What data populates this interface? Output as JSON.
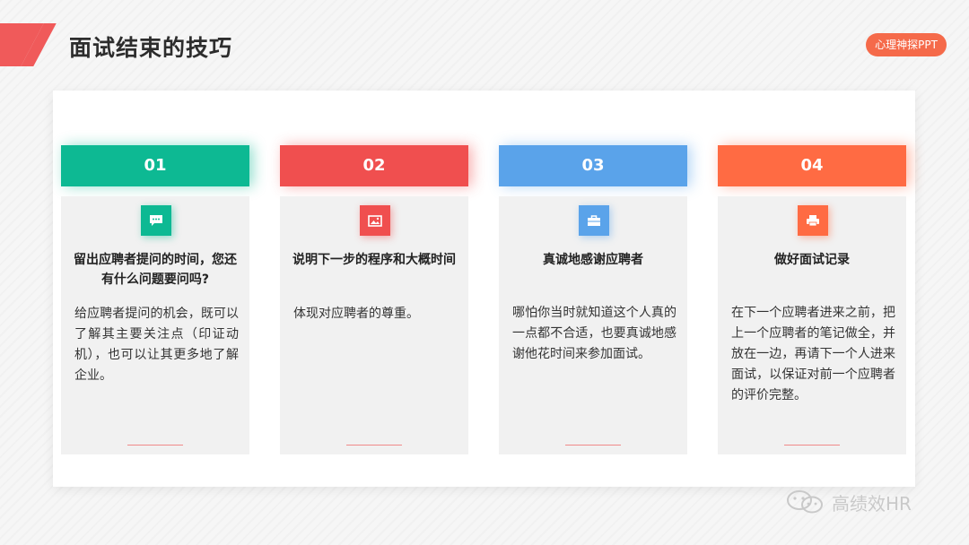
{
  "header": {
    "title": "面试结束的技巧",
    "brand_pill": "心理神探PPT"
  },
  "steps": [
    {
      "number": "01",
      "icon": "chat-icon",
      "color": "#0db993",
      "heading": "留出应聘者提问的时间，您还有什么问题要问吗?",
      "body": "给应聘者提问的机会，既可以了解其主要关注点（印证动机），也可以让其更多地了解企业。"
    },
    {
      "number": "02",
      "icon": "image-icon",
      "color": "#f04f4f",
      "heading": "说明下一步的程序和大概时间",
      "body": "体现对应聘者的尊重。"
    },
    {
      "number": "03",
      "icon": "briefcase-icon",
      "color": "#5aa3ea",
      "heading": "真诚地感谢应聘者",
      "body": "哪怕你当时就知道这个人真的一点都不合适，也要真诚地感谢他花时间来参加面试。"
    },
    {
      "number": "04",
      "icon": "printer-icon",
      "color": "#ff6b43",
      "heading": "做好面试记录",
      "body": "在下一个应聘者进来之前，把上一个应聘者的笔记做全，并放在一边，再请下一个人进来面试，以保证对前一个应聘者的评价完整。"
    }
  ],
  "watermark": {
    "text": "高绩效HR",
    "icon": "wechat-icon"
  }
}
